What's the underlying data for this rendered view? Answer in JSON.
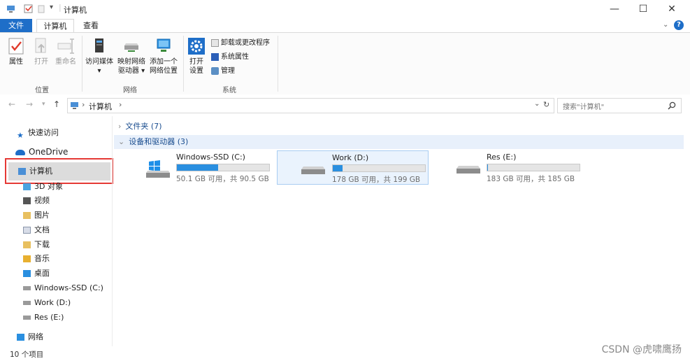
{
  "window": {
    "title": "计算机",
    "minimize": "—",
    "maximize": "☐",
    "close": "✕"
  },
  "tabs": [
    {
      "label": "文件"
    },
    {
      "label": "计算机"
    },
    {
      "label": "查看"
    }
  ],
  "ribbon": {
    "location_group": {
      "label": "位置",
      "buttons": [
        {
          "label": "属性",
          "enabled": true
        },
        {
          "label": "打开",
          "enabled": false
        },
        {
          "label": "重命名",
          "enabled": false
        }
      ]
    },
    "network_group": {
      "label": "网络",
      "buttons": [
        {
          "line1": "访问媒体",
          "line2": "▾"
        },
        {
          "line1": "映射网络",
          "line2": "驱动器 ▾"
        },
        {
          "line1": "添加一个",
          "line2": "网络位置"
        }
      ]
    },
    "system_group": {
      "label": "系统",
      "open_settings": {
        "line1": "打开",
        "line2": "设置"
      },
      "small": [
        {
          "label": "卸载或更改程序"
        },
        {
          "label": "系统属性"
        },
        {
          "label": "管理"
        }
      ]
    }
  },
  "address": {
    "path": [
      "计算机"
    ],
    "search_placeholder": "搜索\"计算机\""
  },
  "nav": {
    "quick_access": "快速访问",
    "onedrive": "OneDrive",
    "this_pc": "计算机",
    "children": [
      "3D 对象",
      "视频",
      "图片",
      "文档",
      "下载",
      "音乐",
      "桌面",
      "Windows-SSD (C:)",
      "Work (D:)",
      "Res (E:)"
    ],
    "network": "网络"
  },
  "content": {
    "folders_section": "文件夹 (7)",
    "devices_section": "设备和驱动器 (3)",
    "drives": [
      {
        "name": "Windows-SSD (C:)",
        "info": "50.1 GB 可用，共 90.5 GB",
        "used_fraction": 0.446
      },
      {
        "name": "Work (D:)",
        "info": "178 GB 可用，共 199 GB",
        "used_fraction": 0.106
      },
      {
        "name": "Res (E:)",
        "info": "183 GB 可用，共 185 GB",
        "used_fraction": 0.011
      }
    ]
  },
  "status": {
    "item_count": "10 个项目"
  },
  "watermark": "CSDN @虎啸鹰扬",
  "colors": {
    "accent": "#1e6ec8",
    "drive_fill": "#2a8fe0",
    "highlight": "#e53935"
  }
}
